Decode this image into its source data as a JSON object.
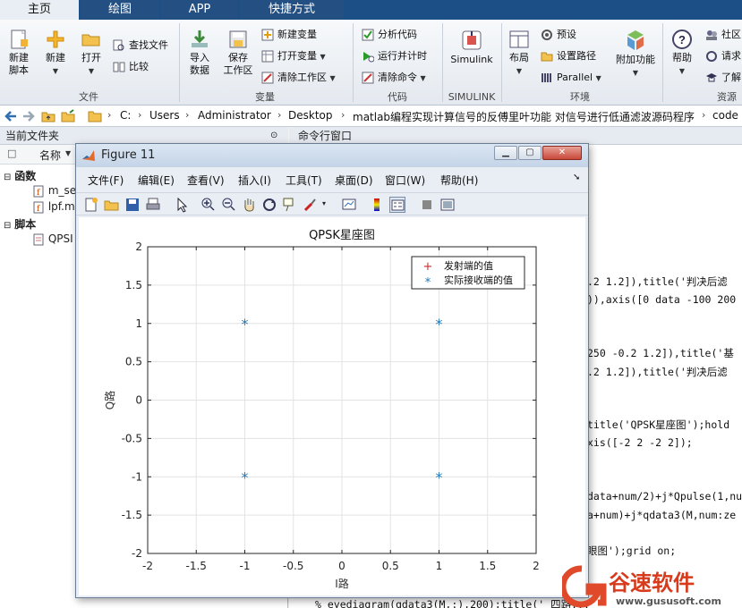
{
  "tabs": [
    "主页",
    "绘图",
    "APP",
    "快捷方式"
  ],
  "ribbon": {
    "new_script": [
      "新建",
      "脚本"
    ],
    "new": "新建",
    "open": "打开",
    "find_files": "查找文件",
    "compare": "比较",
    "import_data": [
      "导入",
      "数据"
    ],
    "save_workspace": [
      "保存",
      "工作区"
    ],
    "new_variable": "新建变量",
    "open_variable": "打开变量",
    "clear_workspace": "清除工作区",
    "analyze_code": "分析代码",
    "run_and_time": "运行并计时",
    "clear_commands": "清除命令",
    "simulink": "Simulink",
    "layout": "布局",
    "preferences": "预设",
    "set_path": "设置路径",
    "parallel": "Parallel",
    "addons": "附加功能",
    "help": "帮助",
    "community": "社区",
    "request_support": "请求",
    "learn": "了解",
    "groups": [
      "文件",
      "变量",
      "代码",
      "SIMULINK",
      "环境",
      "资源"
    ]
  },
  "address": {
    "crumbs": [
      "C:",
      "Users",
      "Administrator",
      "Desktop",
      "matlab编程实现计算信号的反傅里叶功能 对信号进行低通滤波源码程序",
      "code"
    ]
  },
  "left_panel": {
    "title": "当前文件夹",
    "column": "名称",
    "groups": [
      {
        "label": "函数",
        "files": [
          "m_se",
          "lpf.m"
        ]
      },
      {
        "label": "脚本",
        "files": [
          "QPSI"
        ]
      }
    ]
  },
  "command_window": {
    "title": "命令行窗口",
    "lines": [
      ".2 1.2]),title('判决后滤",
      ")),axis([0 data -100 200",
      "250 -0.2 1.2]),title('基",
      ".2 1.2]),title('判决后滤",
      "title('QPSK星座图');hold",
      "xis([-2 2 -2 2]);",
      "data+num/2)+j*Qpulse(1,nu",
      "a+num)+j*qdata3(M,num:ze",
      "眼图');grid on;",
      "% eyediagram(qdata3(M,:),200);title(' 四路..."
    ]
  },
  "figure": {
    "title": "Figure 11",
    "menu": [
      "文件(F)",
      "编辑(E)",
      "查看(V)",
      "插入(I)",
      "工具(T)",
      "桌面(D)",
      "窗口(W)",
      "帮助(H)"
    ]
  },
  "chart_data": {
    "type": "scatter",
    "title": "QPSK星座图",
    "xlabel": "I路",
    "ylabel": "Q路",
    "xlim": [
      -2,
      2
    ],
    "ylim": [
      -2,
      2
    ],
    "xticks": [
      -2,
      -1.5,
      -1,
      -0.5,
      0,
      0.5,
      1,
      1.5,
      2
    ],
    "yticks": [
      -2,
      -1.5,
      -1,
      -0.5,
      0,
      0.5,
      1,
      1.5,
      2
    ],
    "grid": true,
    "legend_position": "top-right",
    "series": [
      {
        "name": "发射端的值",
        "marker": "+",
        "color": "#d62728",
        "points": []
      },
      {
        "name": "实际接收端的值",
        "marker": "*",
        "color": "#1f77b4",
        "points": [
          [
            -1,
            1
          ],
          [
            1,
            1
          ],
          [
            -1,
            -1
          ],
          [
            1,
            -1
          ]
        ]
      }
    ]
  },
  "watermark": {
    "brand": "谷速软件",
    "url": "www.gususoft.com"
  },
  "colors": {
    "accent": "#1d4f87",
    "series_blue": "#1f77b4",
    "series_red": "#d62728"
  }
}
